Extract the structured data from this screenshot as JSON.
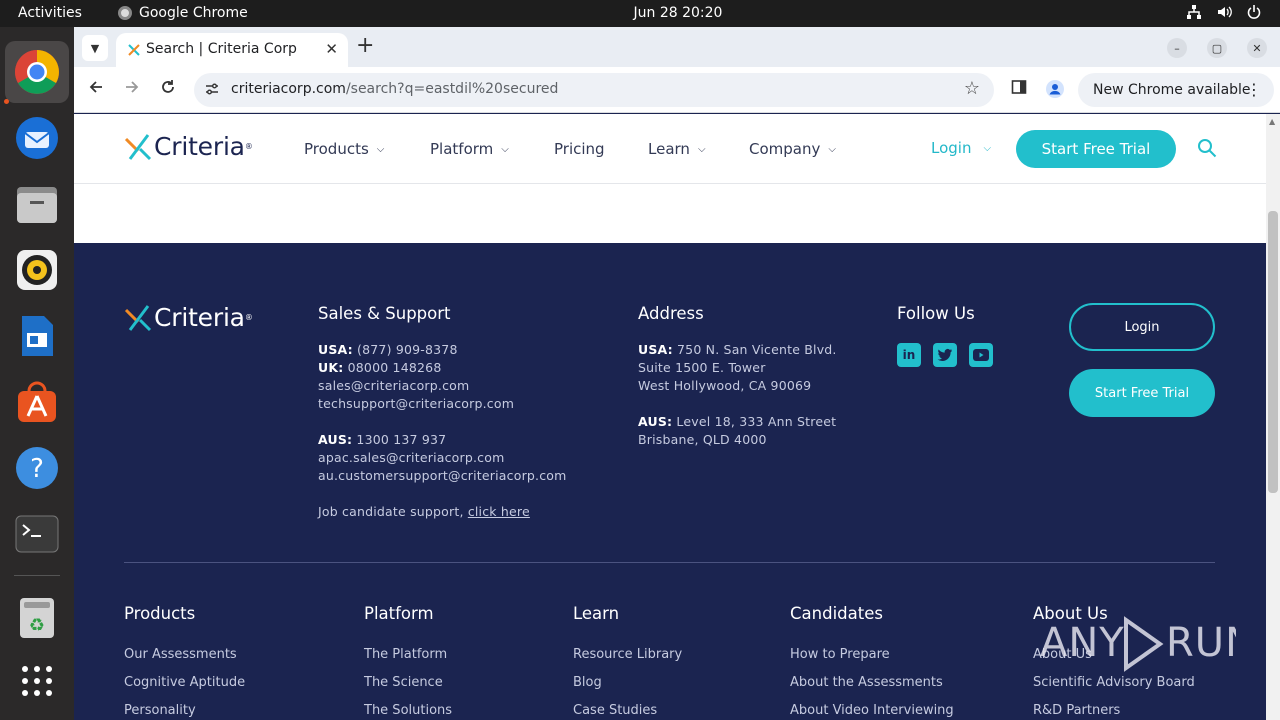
{
  "os": {
    "activities": "Activities",
    "app_name": "Google Chrome",
    "clock": "Jun 28  20:20"
  },
  "browser": {
    "tab_title": "Search | Criteria Corp",
    "url_host": "criteriacorp.com",
    "url_path": "/search?q=eastdil%20secured",
    "update_label": "New Chrome available"
  },
  "header": {
    "logo_text": "Criteria",
    "nav": [
      "Products",
      "Platform",
      "Pricing",
      "Learn",
      "Company"
    ],
    "login": "Login",
    "cta": "Start Free Trial"
  },
  "footer": {
    "logo_text": "Criteria",
    "sales": {
      "heading": "Sales & Support",
      "usa_label": "USA:",
      "usa_phone": " (877) 909-8378",
      "uk_label": "UK:",
      "uk_phone": " 08000 148268",
      "email1": "sales@criteriacorp.com",
      "email2": "techsupport@criteriacorp.com",
      "aus_label": "AUS:",
      "aus_phone": " 1300 137 937",
      "email3": "apac.sales@criteriacorp.com",
      "email4": "au.customersupport@criteriacorp.com",
      "candidate_text": "Job candidate support, ",
      "candidate_link": "click here"
    },
    "address": {
      "heading": "Address",
      "usa_label": "USA:",
      "usa_line1": " 750 N. San Vicente Blvd.",
      "usa_line2": "Suite 1500 E. Tower",
      "usa_line3": "West Hollywood, CA 90069",
      "aus_label": "AUS:",
      "aus_line1": " Level 18, 333 Ann Street",
      "aus_line2": "Brisbane, QLD 4000"
    },
    "follow": {
      "heading": "Follow Us",
      "networks": [
        "linkedin",
        "twitter",
        "youtube"
      ]
    },
    "login_button": "Login",
    "trial_button": "Start Free Trial",
    "columns": [
      {
        "heading": "Products",
        "links": [
          "Our Assessments",
          "Cognitive Aptitude",
          "Personality"
        ]
      },
      {
        "heading": "Platform",
        "links": [
          "The Platform",
          "The Science",
          "The Solutions"
        ]
      },
      {
        "heading": "Learn",
        "links": [
          "Resource Library",
          "Blog",
          "Case Studies"
        ]
      },
      {
        "heading": "Candidates",
        "links": [
          "How to Prepare",
          "About the Assessments",
          "About Video Interviewing"
        ]
      },
      {
        "heading": "About Us",
        "links": [
          "About Us",
          "Scientific Advisory Board",
          "R&D Partners"
        ]
      }
    ]
  },
  "watermark": "ANY RUN",
  "colors": {
    "navy": "#1b2450",
    "teal": "#22bfcc",
    "orange": "#f08a24"
  }
}
